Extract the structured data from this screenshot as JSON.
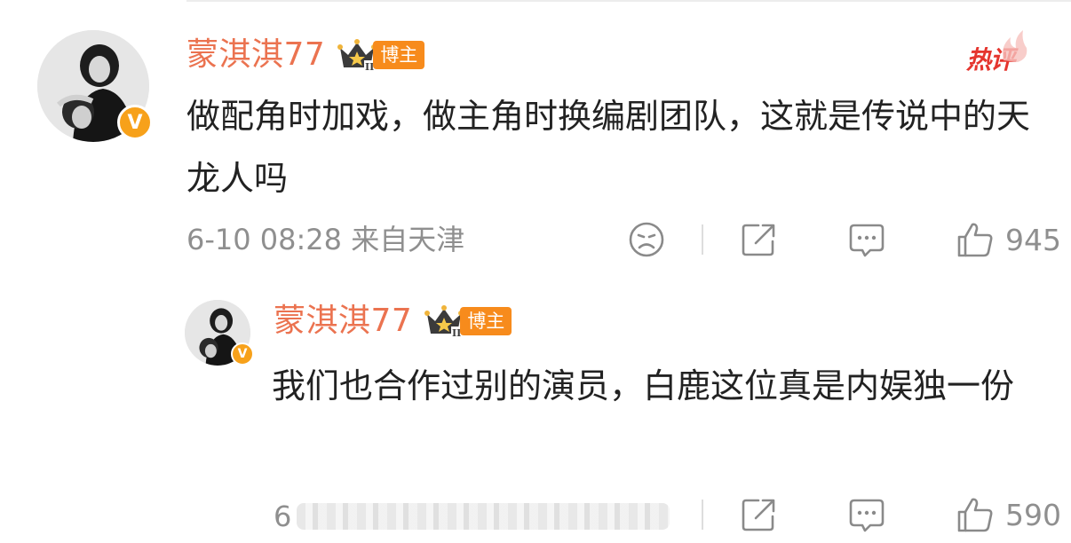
{
  "colors": {
    "username": "#eb7350",
    "role_badge_bg": "#f78b1c",
    "verified_badge": "#f7a11a",
    "hot_badge": "#e5352e",
    "meta_text": "#8f8f8f"
  },
  "comment": {
    "username": "蒙淇淇77",
    "role_badge": "博主",
    "hot_badge": "热评",
    "verified_icon": "v-verified-icon",
    "text": "做配角时加戏，做主角时换编剧团队，这就是传说中的天龙人吗",
    "time": "6-10 08:28 来自天津",
    "like_count": "945",
    "icons": [
      "dislike-face-icon",
      "share-icon",
      "comment-icon",
      "like-thumb-icon"
    ]
  },
  "reply": {
    "username": "蒙淇淇77",
    "role_badge": "博主",
    "verified_icon": "v-verified-icon",
    "text": "我们也合作过别的演员，白鹿这位真是内娱独一份",
    "time_visible": "6",
    "like_count": "590",
    "icons": [
      "dislike-face-icon",
      "share-icon",
      "comment-icon",
      "like-thumb-icon"
    ]
  }
}
